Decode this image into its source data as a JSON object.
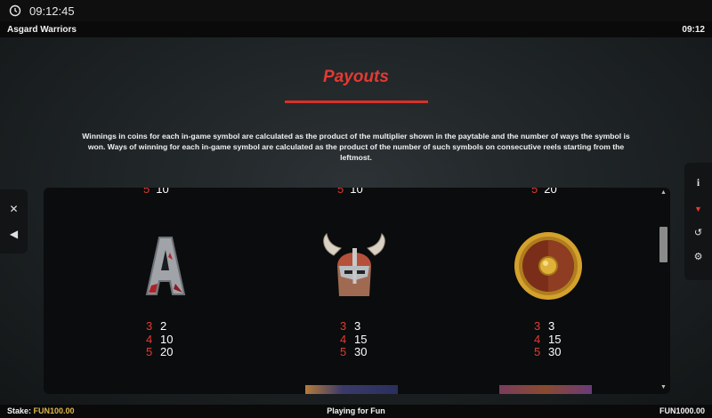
{
  "system": {
    "time": "09:12:45",
    "clock_icon": "clock-icon"
  },
  "game": {
    "title": "Asgard Warriors",
    "time": "09:12"
  },
  "payouts": {
    "heading": "Payouts",
    "description": "Winnings in coins for each in-game symbol are calculated as the product of the multiplier shown in the paytable and the number of ways the symbol is won. Ways of winning for each in-game symbol are calculated as the product of the number of such symbols on consecutive reels starting from the leftmost.",
    "partial_row": [
      {
        "count": "5",
        "value": "10"
      },
      {
        "count": "5",
        "value": "10"
      },
      {
        "count": "5",
        "value": "20"
      }
    ],
    "symbols": [
      {
        "name": "A",
        "icon": "letter-a-symbol",
        "rows": [
          {
            "count": "3",
            "value": "2"
          },
          {
            "count": "4",
            "value": "10"
          },
          {
            "count": "5",
            "value": "20"
          }
        ]
      },
      {
        "name": "helmet",
        "icon": "viking-helmet-symbol",
        "rows": [
          {
            "count": "3",
            "value": "3"
          },
          {
            "count": "4",
            "value": "15"
          },
          {
            "count": "5",
            "value": "30"
          }
        ]
      },
      {
        "name": "shield",
        "icon": "round-shield-symbol",
        "rows": [
          {
            "count": "3",
            "value": "3"
          },
          {
            "count": "4",
            "value": "15"
          },
          {
            "count": "5",
            "value": "30"
          }
        ]
      }
    ]
  },
  "left_controls": [
    {
      "icon": "close-icon",
      "glyph": "✕"
    },
    {
      "icon": "sound-icon",
      "glyph": "◀"
    }
  ],
  "right_controls": [
    {
      "icon": "info-icon",
      "glyph": "i"
    },
    {
      "icon": "paytable-icon",
      "glyph": "▼"
    },
    {
      "icon": "history-icon",
      "glyph": "↺"
    },
    {
      "icon": "settings-icon",
      "glyph": "⚙"
    }
  ],
  "footer": {
    "stake_label": "Stake:",
    "stake_value": "FUN100.00",
    "mode": "Playing for Fun",
    "balance": "FUN1000.00"
  },
  "colors": {
    "accent_red": "#e33a32",
    "stake_gold": "#e0b84a"
  }
}
